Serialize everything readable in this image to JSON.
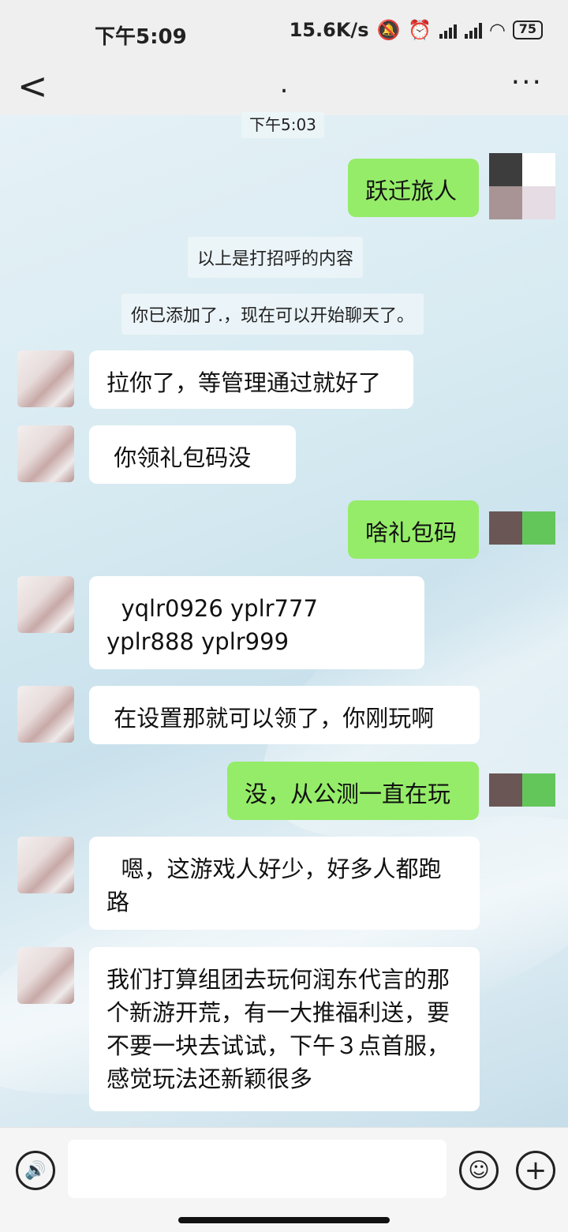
{
  "status_bar": {
    "time": "下午5:09",
    "speed": "15.6K/s",
    "battery": "75"
  },
  "header": {
    "title": ".",
    "back": "<",
    "more": "···"
  },
  "messages": {
    "timestamp": "下午5:03",
    "m1": "跃迁旅人",
    "sys1": "以上是打招呼的内容",
    "sys2": "你已添加了.，现在可以开始聊天了。",
    "m2": "拉你了，等管理通过就好了",
    "m3": " 你领礼包码没",
    "m4": "啥礼包码",
    "m5": "  yqlr0926 yplr777 yplr888 yplr999",
    "m6": " 在设置那就可以领了，你刚玩啊",
    "m7": "没，从公测一直在玩",
    "m8": "  嗯，这游戏人好少，好多人都跑路",
    "m9": "我们打算组团去玩何润东代言的那个新游开荒，有一大推福利送，要不要一块去试试，下午３点首服，感觉玩法还新颖很多"
  },
  "input": {
    "placeholder": ""
  },
  "colors": {
    "outgoing": "#95ec69",
    "incoming": "#ffffff",
    "bar": "#efefef"
  }
}
